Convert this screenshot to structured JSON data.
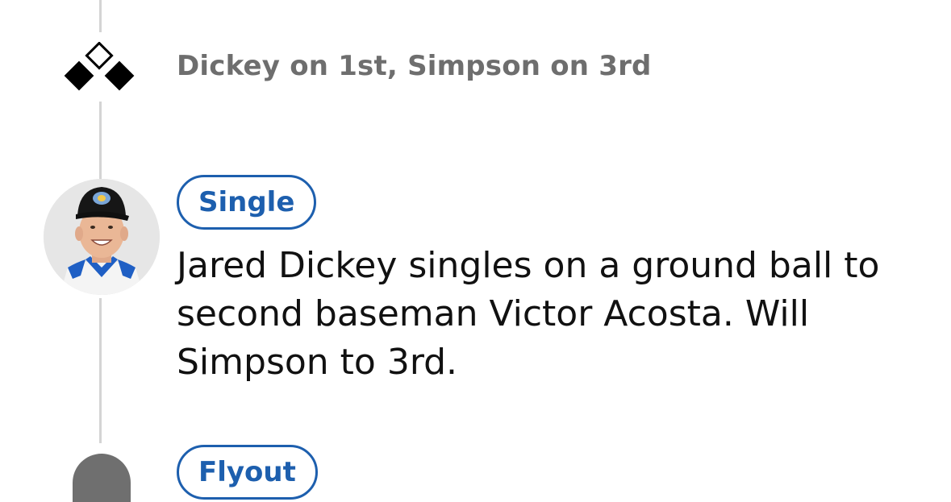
{
  "runners_event": {
    "icon": "bases-diamond-icon",
    "text": "Dickey on 1st, Simpson on 3rd",
    "first_base_occupied": true,
    "second_base_occupied": false,
    "third_base_occupied": true
  },
  "play": {
    "tag": "Single",
    "description": "Jared Dickey singles on a ground ball to second baseman Victor Acosta. Will Simpson to 3rd.",
    "player_avatar": "player-headshot"
  },
  "next_play": {
    "tag": "Flyout"
  },
  "colors": {
    "accent": "#1d5fae",
    "muted_text": "#6e6e6e",
    "body_text": "#111111",
    "timeline": "#d4d4d4"
  }
}
